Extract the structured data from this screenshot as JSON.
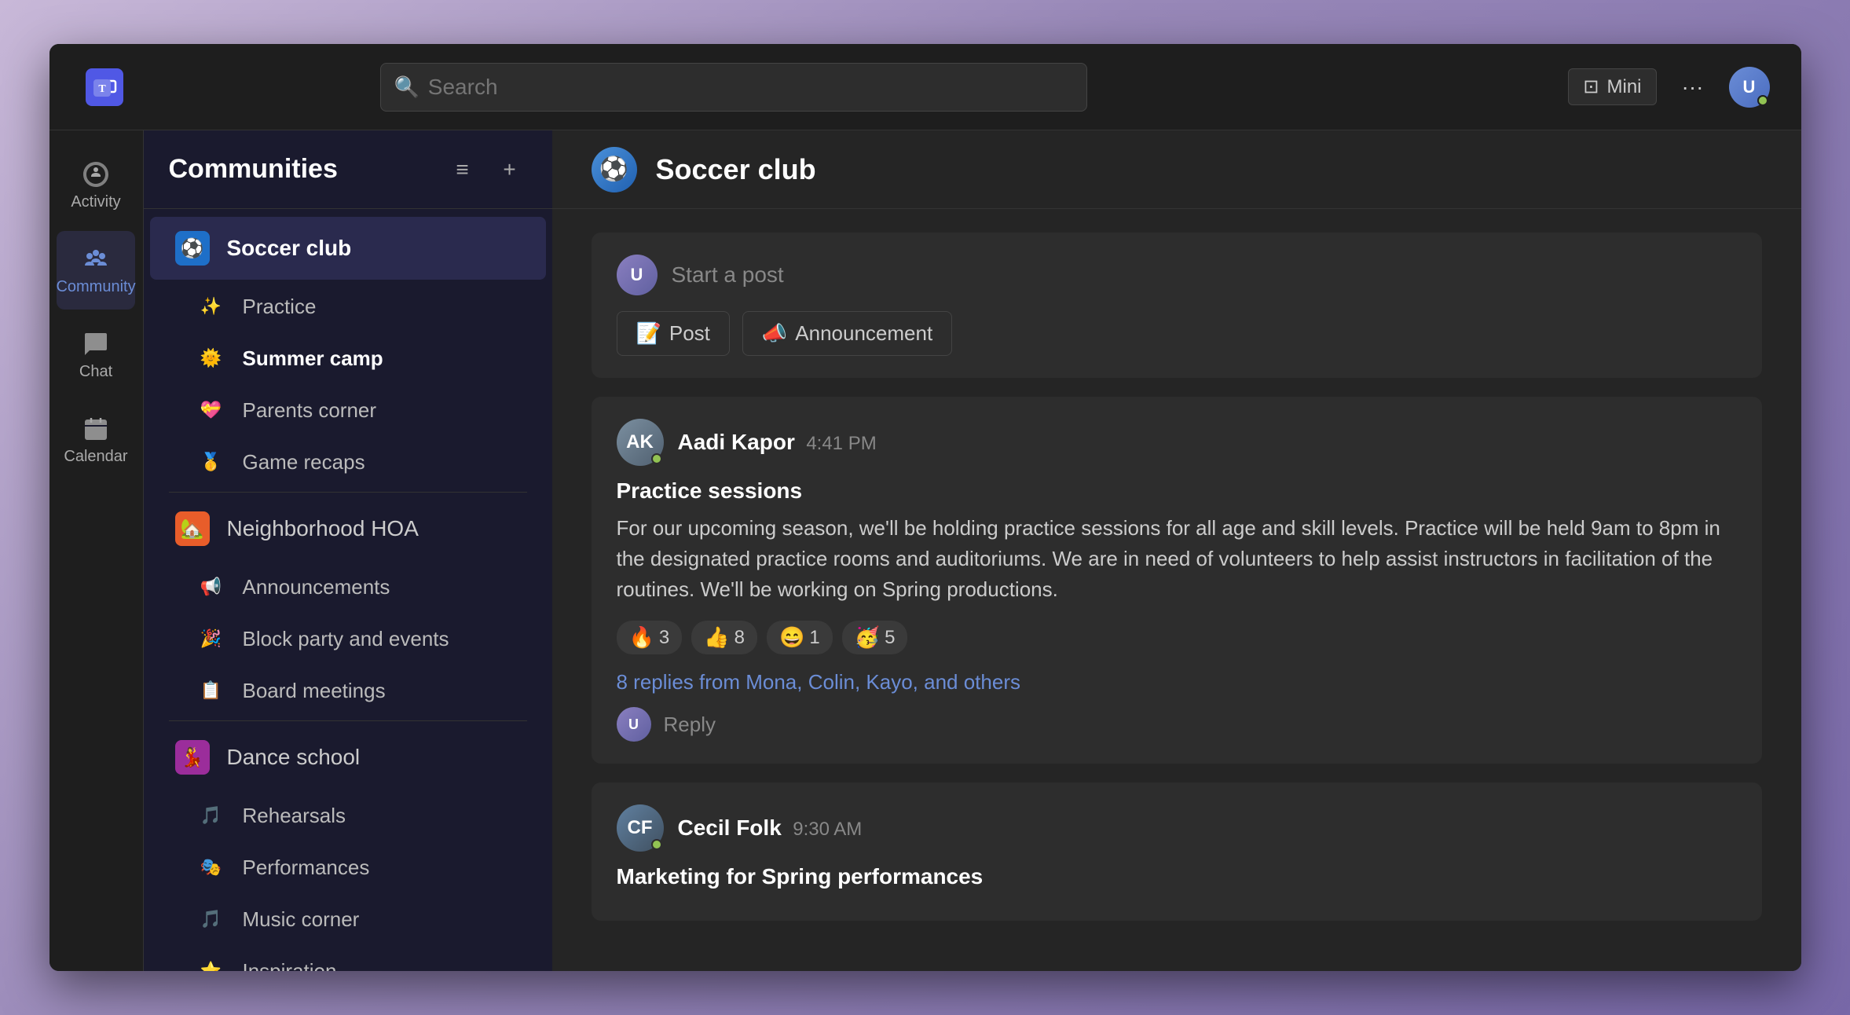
{
  "titlebar": {
    "search_placeholder": "Search",
    "mini_label": "Mini",
    "dots": "···"
  },
  "sidebar": {
    "title": "Communities",
    "filter_icon": "≡",
    "add_icon": "+",
    "communities": [
      {
        "id": "soccer-club",
        "name": "Soccer club",
        "icon": "⚽",
        "icon_bg": "#1e6fc8",
        "active": true,
        "bold": true,
        "channels": [
          {
            "id": "practice",
            "name": "Practice",
            "icon": "✨"
          },
          {
            "id": "summer-camp",
            "name": "Summer camp",
            "icon": "🌞",
            "bold": true
          },
          {
            "id": "parents-corner",
            "name": "Parents corner",
            "icon": "💝"
          },
          {
            "id": "game-recaps",
            "name": "Game recaps",
            "icon": "🥇"
          }
        ]
      },
      {
        "id": "neighborhood-hoa",
        "name": "Neighborhood HOA",
        "icon": "🏡",
        "icon_bg": "#e85d2a",
        "active": false,
        "channels": [
          {
            "id": "announcements",
            "name": "Announcements",
            "icon": "📢"
          },
          {
            "id": "block-party",
            "name": "Block party and events",
            "icon": "🎉"
          },
          {
            "id": "board-meetings",
            "name": "Board meetings",
            "icon": "📋"
          }
        ]
      },
      {
        "id": "dance-school",
        "name": "Dance school",
        "icon": "💃",
        "icon_bg": "#9b2d9b",
        "active": false,
        "channels": [
          {
            "id": "rehearsals",
            "name": "Rehearsals",
            "icon": "🎵"
          },
          {
            "id": "performances",
            "name": "Performances",
            "icon": "🎭"
          },
          {
            "id": "music-corner",
            "name": "Music corner",
            "icon": "🎵"
          },
          {
            "id": "inspiration",
            "name": "Inspiration",
            "icon": "⭐"
          }
        ]
      }
    ]
  },
  "channel": {
    "icon": "⚽",
    "name": "Soccer club"
  },
  "composer": {
    "placeholder": "Start a post",
    "post_btn": "Post",
    "announcement_btn": "Announcement"
  },
  "posts": [
    {
      "id": "post1",
      "author": "Aadi Kapor",
      "time": "4:41 PM",
      "title": "Practice sessions",
      "body": "For our upcoming season, we'll be holding practice sessions for all age and skill levels. Practice will be held 9am to 8pm in the designated practice rooms and auditoriums. We are in need of volunteers to help assist instructors in facilitation of the routines. We'll be working on Spring productions.",
      "reactions": [
        {
          "emoji": "🔥",
          "count": "3"
        },
        {
          "emoji": "👍",
          "count": "8"
        },
        {
          "emoji": "😄",
          "count": "1"
        },
        {
          "emoji": "🥳",
          "count": "5"
        }
      ],
      "replies_text": "8 replies from Mona, Colin, Kayo, and others",
      "reply_label": "Reply"
    },
    {
      "id": "post2",
      "author": "Cecil Folk",
      "time": "9:30 AM",
      "title": "Marketing for Spring performances",
      "body": ""
    }
  ],
  "nav": {
    "items": [
      {
        "id": "activity",
        "label": "Activity"
      },
      {
        "id": "community",
        "label": "Community",
        "active": true
      },
      {
        "id": "chat",
        "label": "Chat"
      },
      {
        "id": "calendar",
        "label": "Calendar"
      }
    ]
  },
  "colors": {
    "accent": "#6b8dd6",
    "bg_dark": "#1e1e1e",
    "bg_sidebar": "#1a1a2e",
    "bg_main": "#252525",
    "bg_card": "#2d2d2d",
    "online_green": "#92c353"
  }
}
